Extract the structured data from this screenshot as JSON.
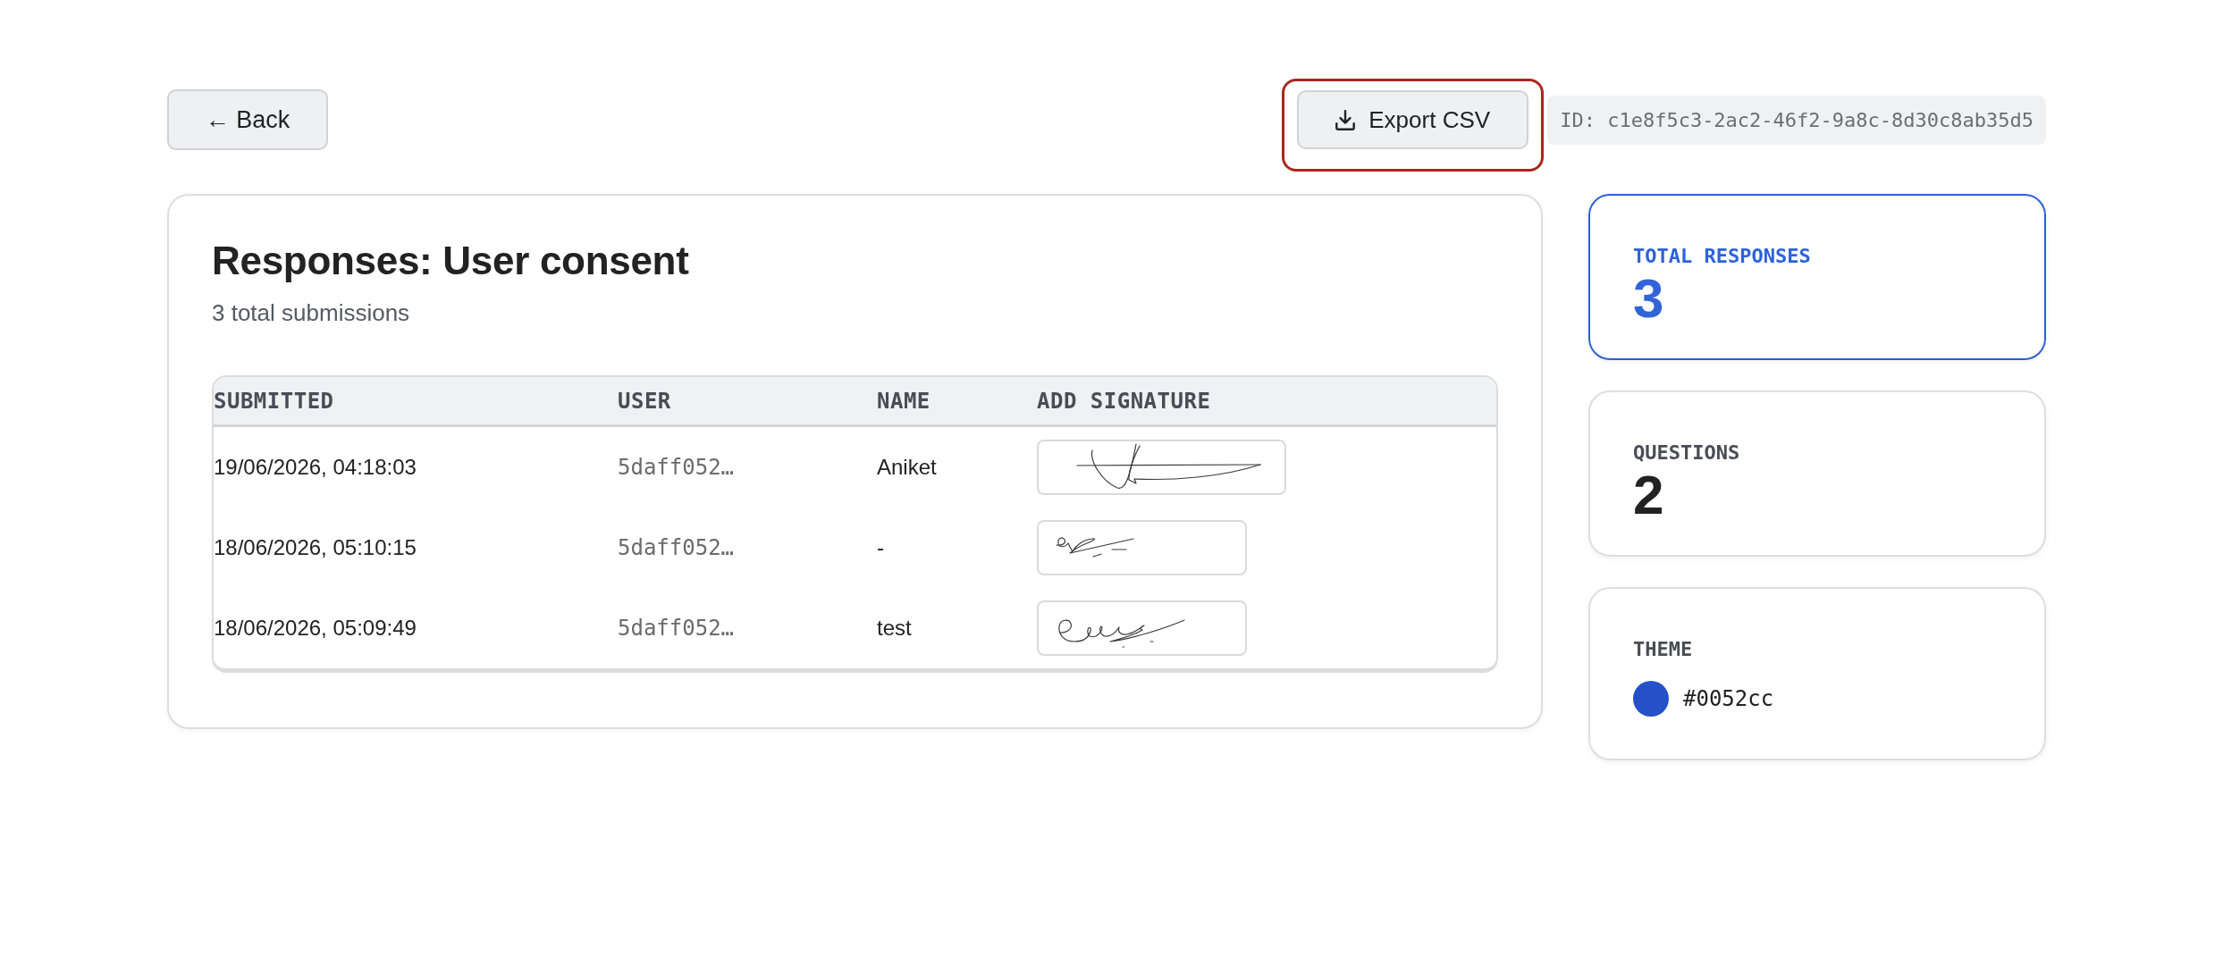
{
  "toolbar": {
    "back": {
      "label": "← Back"
    },
    "export": {
      "label": "Export CSV",
      "highlighted": true
    },
    "id_tag": "ID: c1e8f5c3-2ac2-46f2-9a8c-8d30c8ab35d5"
  },
  "page": {
    "title": "Responses: User consent",
    "subtitle": "3 total submissions"
  },
  "table": {
    "columns": [
      "SUBMITTED",
      "USER",
      "NAME",
      "ADD SIGNATURE"
    ],
    "rows": [
      {
        "submitted": "19/06/2026, 04:18:03",
        "user": "5daff052…",
        "name": "Aniket"
      },
      {
        "submitted": "18/06/2026, 05:10:15",
        "user": "5daff052…",
        "name": "-"
      },
      {
        "submitted": "18/06/2026, 05:09:49",
        "user": "5daff052…",
        "name": "test"
      }
    ]
  },
  "stats": [
    {
      "kind": "number",
      "label": "TOTAL RESPONSES",
      "value": "3",
      "highlighted": true
    },
    {
      "kind": "number",
      "label": "QUESTIONS",
      "value": "2",
      "highlighted": false
    },
    {
      "kind": "swatch",
      "label": "THEME",
      "value": "#0052cc",
      "color": "#2451c8",
      "highlighted": false
    }
  ]
}
